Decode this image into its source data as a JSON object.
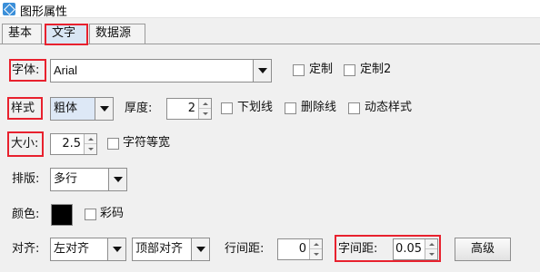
{
  "window": {
    "title": "图形属性"
  },
  "tabs": [
    {
      "label": "基本"
    },
    {
      "label": "文字"
    },
    {
      "label": "数据源"
    }
  ],
  "font": {
    "label": "字体:",
    "value": "Arial",
    "options": [
      {
        "label": "定制",
        "checked": false
      },
      {
        "label": "定制2",
        "checked": false
      }
    ]
  },
  "style": {
    "label": "样式",
    "value": "粗体",
    "thickness_label": "厚度:",
    "thickness_value": "2",
    "options": [
      {
        "label": "下划线",
        "checked": false
      },
      {
        "label": "删除线",
        "checked": false
      },
      {
        "label": "动态样式",
        "checked": false
      }
    ]
  },
  "size": {
    "label": "大小:",
    "value": "2.5",
    "monospace_label": "字符等宽",
    "monospace_checked": false
  },
  "layout": {
    "label": "排版:",
    "value": "多行"
  },
  "color": {
    "label": "颜色:",
    "swatch": "#000000",
    "colorcode_label": "彩码",
    "colorcode_checked": false
  },
  "align": {
    "label": "对齐:",
    "horizontal": "左对齐",
    "vertical": "顶部对齐",
    "line_spacing_label": "行间距:",
    "line_spacing_value": "0",
    "char_spacing_label": "字间距:",
    "char_spacing_value": "0.05",
    "advanced_button": "高级"
  },
  "colors": {
    "highlight": "#e8212e",
    "selected_tab_bg": "#d9e6f4"
  }
}
